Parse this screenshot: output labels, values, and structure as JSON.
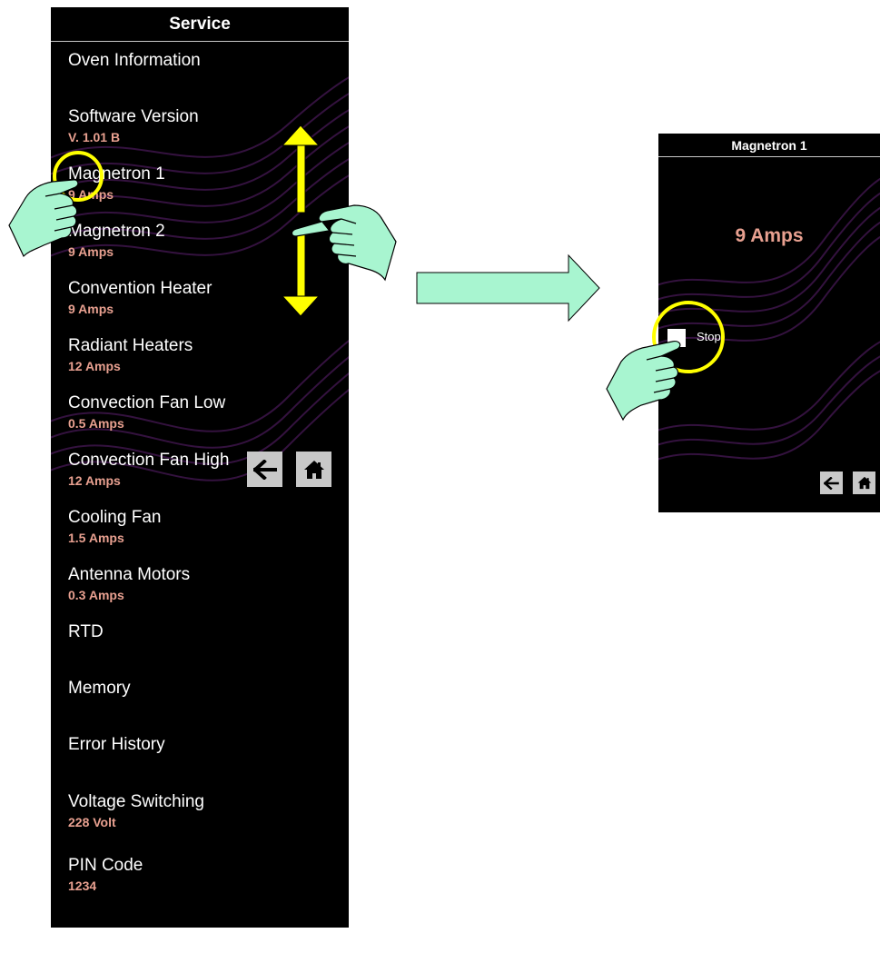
{
  "colors": {
    "panel_bg": "#000000",
    "header_text": "#ffffff",
    "label_text": "#ffffff",
    "value_text": "#e8a090",
    "nav_button_bg": "#c8c8c8",
    "gesture_arrow": "#ffff00",
    "hand": "#a8f5d0",
    "flow_arrow": "#a8f5d0"
  },
  "service_screen": {
    "title": "Service",
    "items": [
      {
        "label": "Oven Information",
        "value": ""
      },
      {
        "label": "Software Version",
        "value": "V. 1.01 B"
      },
      {
        "label": "Magnetron 1",
        "value": "9 Amps"
      },
      {
        "label": "Magnetron 2",
        "value": "9 Amps"
      },
      {
        "label": "Convention Heater",
        "value": "9 Amps"
      },
      {
        "label": "Radiant Heaters",
        "value": "12 Amps"
      },
      {
        "label": "Convection Fan Low",
        "value": "0.5 Amps"
      },
      {
        "label": "Convection Fan High",
        "value": "12 Amps"
      },
      {
        "label": "Cooling Fan",
        "value": "1.5 Amps"
      },
      {
        "label": "Antenna Motors",
        "value": "0.3 Amps"
      },
      {
        "label": "RTD",
        "value": ""
      },
      {
        "label": "Memory",
        "value": ""
      },
      {
        "label": "Error History",
        "value": ""
      },
      {
        "label": "Voltage Switching",
        "value": "228 Volt"
      },
      {
        "label": "PIN Code",
        "value": "1234"
      }
    ],
    "nav": {
      "back_icon": "arrow-left-icon",
      "home_icon": "home-icon"
    }
  },
  "detail_screen": {
    "title": "Magnetron 1",
    "value": "9 Amps",
    "stop_label": "Stop",
    "nav": {
      "back_icon": "arrow-left-icon",
      "home_icon": "home-icon"
    }
  },
  "annotations": {
    "tap_icon": "pointing-hand-icon",
    "swipe_icon": "double-arrow-icon",
    "flow_icon": "right-arrow-icon"
  }
}
